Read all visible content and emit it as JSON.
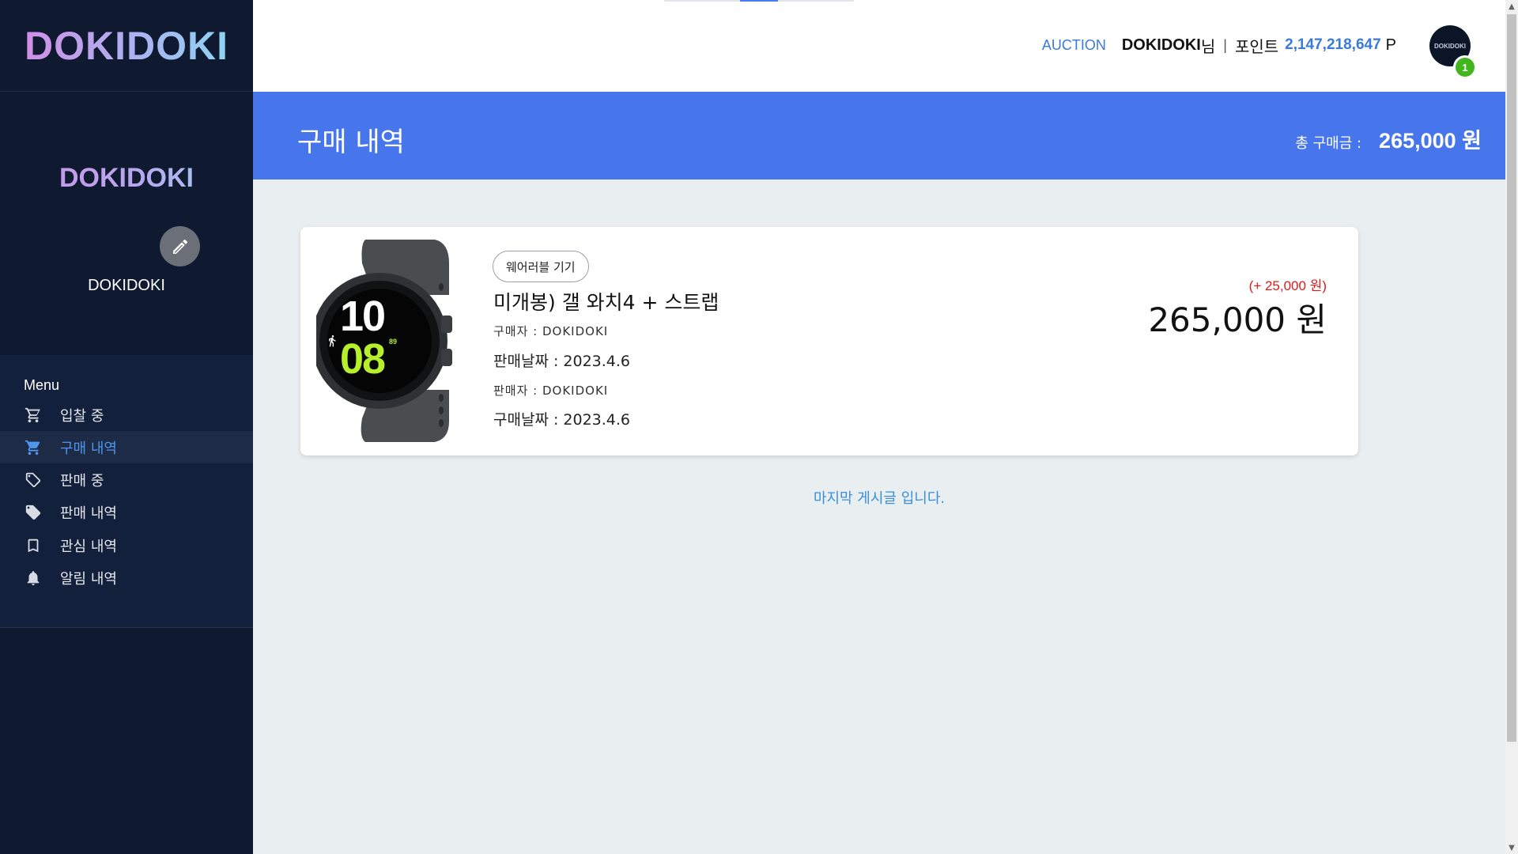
{
  "app": {
    "brand": "DOKIDOKI"
  },
  "profile": {
    "display_title": "DOKIDOKI",
    "name": "DOKIDOKI"
  },
  "menu": {
    "title": "Menu",
    "items": [
      {
        "label": "입찰 중",
        "icon": "cart-outline-icon",
        "active": false
      },
      {
        "label": "구매 내역",
        "icon": "cart-icon",
        "active": true
      },
      {
        "label": "판매 중",
        "icon": "tag-outline-icon",
        "active": false
      },
      {
        "label": "판매 내역",
        "icon": "tag-icon",
        "active": false
      },
      {
        "label": "관심 내역",
        "icon": "bookmark-icon",
        "active": false
      },
      {
        "label": "알림 내역",
        "icon": "bell-icon",
        "active": false
      }
    ]
  },
  "header": {
    "auction_link": "AUCTION",
    "user_name": "DOKIDOKI",
    "user_suffix": "님",
    "separator": "|",
    "points_label": "포인트",
    "points_value": "2,147,218,647",
    "points_unit": "P",
    "avatar_text": "DOKIDOKI",
    "notification_count": "1"
  },
  "banner": {
    "title": "구매 내역",
    "total_label": "총 구매금 :",
    "total_value": "265,000 원"
  },
  "purchases": [
    {
      "category": "웨어러블 기기",
      "title": "미개봉) 갤 와치4 + 스트랩",
      "buyer": "구매자 : DOKIDOKI",
      "sale_date": "판매날짜 : 2023.4.6",
      "seller": "판매자 : DOKIDOKI",
      "purchase_date": "구매날짜 : 2023.4.6",
      "price_diff": "(+ 25,000 원)",
      "price": "265,000 원",
      "image_icon": "smartwatch-image",
      "watch_hour": "10",
      "watch_minute": "08",
      "watch_small": "89"
    }
  ],
  "footer_note": "마지막 게시글 입니다.",
  "colors": {
    "sidebar_bg": "#0f1a30",
    "menu_bg": "#13203b",
    "banner_bg": "#4776ec",
    "accent": "#3a7ad8",
    "badge": "#43b51f",
    "diff_red": "#e01a1a"
  }
}
